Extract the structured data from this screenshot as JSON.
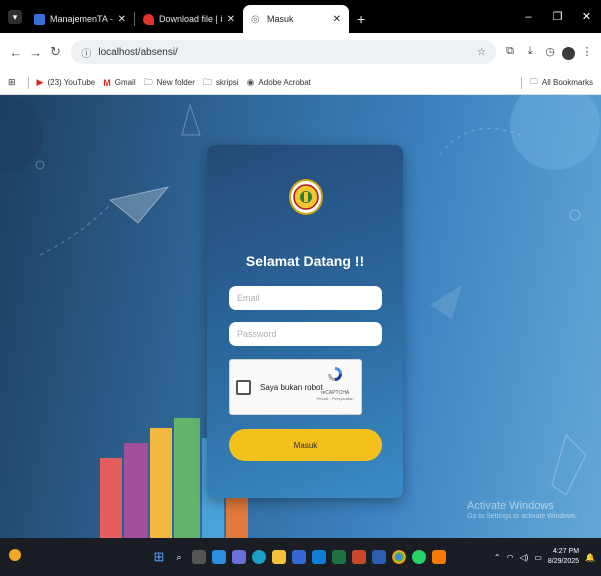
{
  "browser": {
    "tabs": [
      {
        "title": "ManajemenTA - Manajemen TA",
        "favicon_color": "#3b6fd8",
        "active": false
      },
      {
        "title": "Download file | iLovePDF",
        "favicon_color": "#e5322d",
        "active": false
      },
      {
        "title": "Masuk",
        "favicon_color": "#888888",
        "active": true
      }
    ],
    "url": "localhost/absensi/",
    "bookmarks": [
      {
        "label": "(23) YouTube",
        "icon": "youtube-icon"
      },
      {
        "label": "Gmail",
        "icon": "gmail-icon"
      },
      {
        "label": "New folder",
        "icon": "folder-icon"
      },
      {
        "label": "skripsi",
        "icon": "folder-icon"
      },
      {
        "label": "Adobe Acrobat",
        "icon": "acrobat-icon"
      }
    ],
    "all_bookmarks": "All Bookmarks"
  },
  "login": {
    "title": "Selamat Datang !!",
    "email_placeholder": "Email",
    "password_placeholder": "Password",
    "captcha_label": "Saya bukan robot",
    "captcha_brand": "reCAPTCHA",
    "captcha_links": "Privasi - Persyaratan",
    "submit_label": "Masuk"
  },
  "watermark": {
    "line1": "Activate Windows",
    "line2": "Go to Settings to activate Windows."
  },
  "taskbar": {
    "time": "4:27 PM",
    "date": "8/29/2025"
  },
  "colors": {
    "card_start": "#244a77",
    "button": "#f4c01b",
    "background": "#3b82c0"
  }
}
